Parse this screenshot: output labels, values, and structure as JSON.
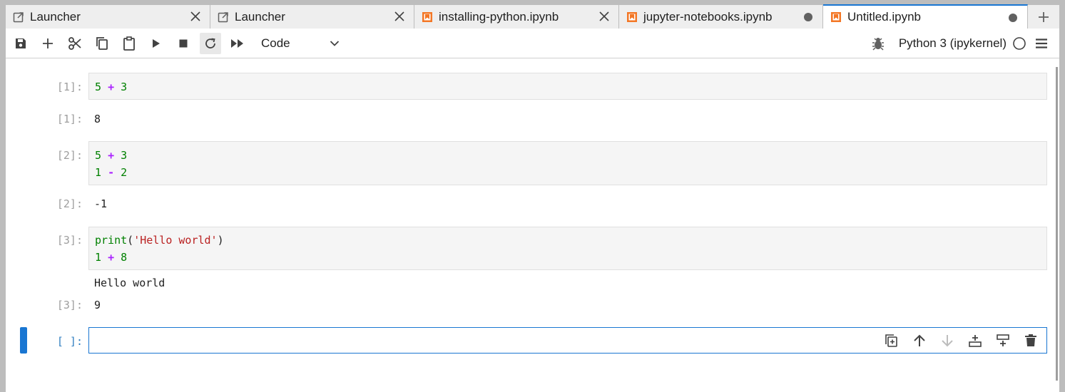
{
  "tabs": [
    {
      "label": "Launcher",
      "icon": "launcher-icon",
      "state": "close"
    },
    {
      "label": "Launcher",
      "icon": "launcher-icon",
      "state": "close"
    },
    {
      "label": "installing-python.ipynb",
      "icon": "notebook-icon",
      "state": "close"
    },
    {
      "label": "jupyter-notebooks.ipynb",
      "icon": "notebook-icon",
      "state": "unsaved"
    },
    {
      "label": "Untitled.ipynb",
      "icon": "notebook-icon",
      "state": "unsaved",
      "active": true
    }
  ],
  "toolbar": {
    "buttons": [
      "save-icon",
      "add-cell-icon",
      "cut-icon",
      "copy-icon",
      "paste-icon",
      "run-icon",
      "stop-icon",
      "restart-icon",
      "fast-forward-icon"
    ],
    "cell_type": "Code",
    "kernel_name": "Python 3 (ipykernel)"
  },
  "cells": [
    {
      "prompt": "[1]:",
      "output_prompt": "[1]:",
      "output": "8"
    },
    {
      "prompt": "[2]:",
      "output_prompt": "[2]:",
      "output": "-1"
    },
    {
      "prompt": "[3]:",
      "stdout": "Hello world",
      "output_prompt": "[3]:",
      "output": "9"
    },
    {
      "prompt": "[ ]:"
    }
  ],
  "code": {
    "c1": {
      "a": "5",
      "op": "+",
      "b": "3"
    },
    "c2l1": {
      "a": "5",
      "op": "+",
      "b": "3"
    },
    "c2l2": {
      "a": "1",
      "op": "-",
      "b": "2"
    },
    "c3l1": {
      "fn": "print",
      "open": "(",
      "str": "'Hello world'",
      "close": ")"
    },
    "c3l2": {
      "a": "1",
      "op": "+",
      "b": "8"
    }
  },
  "colors": {
    "accent": "#1976d2",
    "number": "#008000",
    "operator": "#aa22ff",
    "string": "#ba2121",
    "notebook_icon": "#f37726"
  },
  "cell_tools": [
    "duplicate-cell-icon",
    "move-up-icon",
    "move-down-icon",
    "insert-above-icon",
    "insert-below-icon",
    "delete-cell-icon"
  ]
}
